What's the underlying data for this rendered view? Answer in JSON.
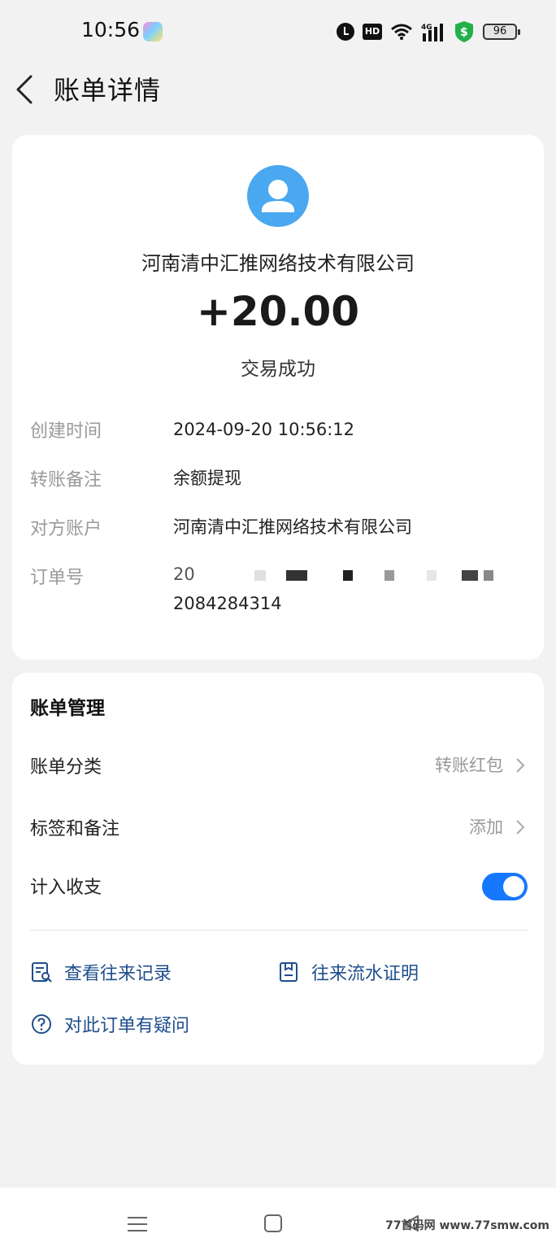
{
  "status_bar": {
    "time": "10:56",
    "hd_label": "HD",
    "network_label": "4G",
    "battery": "96"
  },
  "header": {
    "title": "账单详情"
  },
  "transaction": {
    "counterparty": "河南清中汇推网络技术有限公司",
    "amount": "+20.00",
    "status": "交易成功",
    "details": [
      {
        "label": "创建时间",
        "value": "2024-09-20 10:56:12"
      },
      {
        "label": "转账备注",
        "value": "余额提现"
      },
      {
        "label": "对方账户",
        "value": "河南清中汇推网络技术有限公司"
      },
      {
        "label": "订单号",
        "value_start": "20",
        "value_end": "2084284314"
      }
    ]
  },
  "management": {
    "title": "账单管理",
    "rows": [
      {
        "label": "账单分类",
        "value": "转账红包"
      },
      {
        "label": "标签和备注",
        "value": "添加"
      },
      {
        "label": "计入收支",
        "toggle_on": true
      }
    ],
    "actions": [
      {
        "label": "查看往来记录",
        "icon": "record-search-icon"
      },
      {
        "label": "往来流水证明",
        "icon": "document-icon"
      },
      {
        "label": "对此订单有疑问",
        "icon": "question-icon"
      }
    ]
  },
  "watermark": "77首码网 www.77smw.com",
  "colors": {
    "accent": "#1677ff",
    "link": "#1f4e8c",
    "avatar": "#4aa8f0"
  }
}
